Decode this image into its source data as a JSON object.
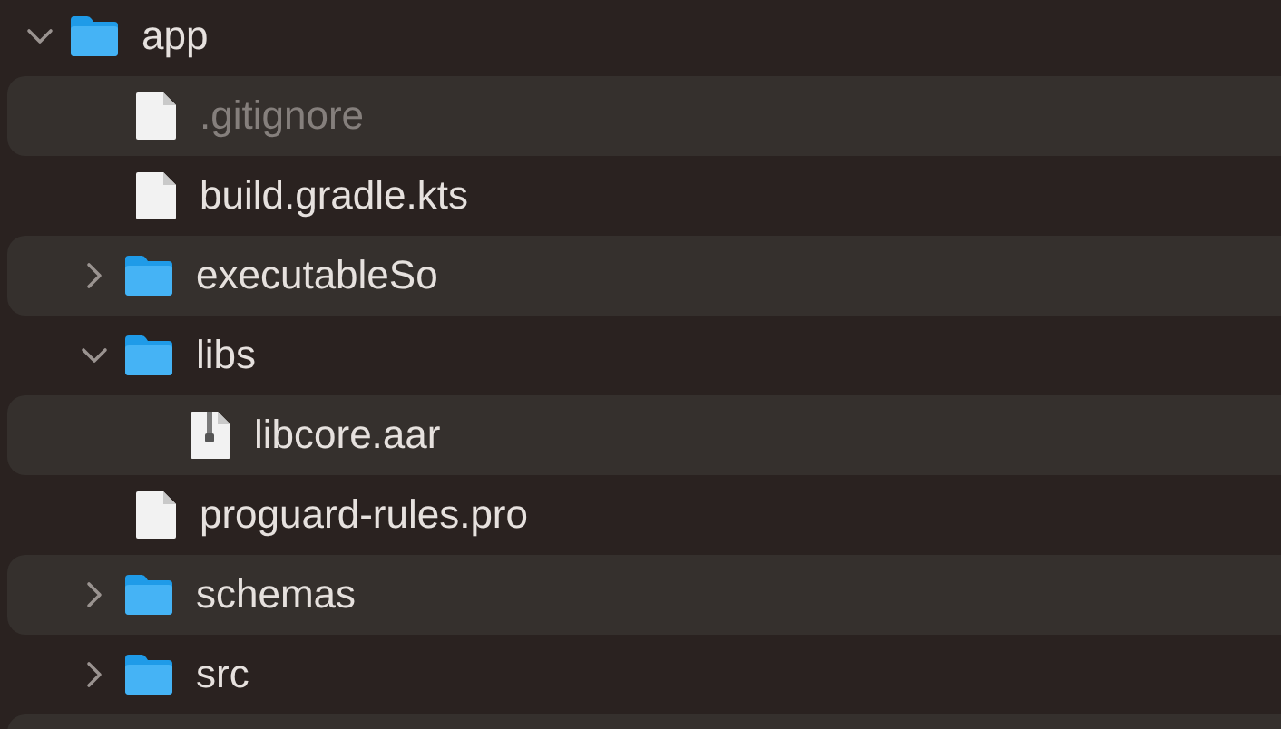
{
  "tree": [
    {
      "name": "app",
      "kind": "folder",
      "expanded": true,
      "children": [
        {
          "name": ".gitignore",
          "kind": "file",
          "hidden": true
        },
        {
          "name": "build.gradle.kts",
          "kind": "file",
          "hidden": false
        },
        {
          "name": "executableSo",
          "kind": "folder",
          "expanded": false
        },
        {
          "name": "libs",
          "kind": "folder",
          "expanded": true,
          "children": [
            {
              "name": "libcore.aar",
              "kind": "archive",
              "hidden": false
            }
          ]
        },
        {
          "name": "proguard-rules.pro",
          "kind": "file",
          "hidden": false
        },
        {
          "name": "schemas",
          "kind": "folder",
          "expanded": false
        },
        {
          "name": "src",
          "kind": "folder",
          "expanded": false
        }
      ]
    }
  ]
}
